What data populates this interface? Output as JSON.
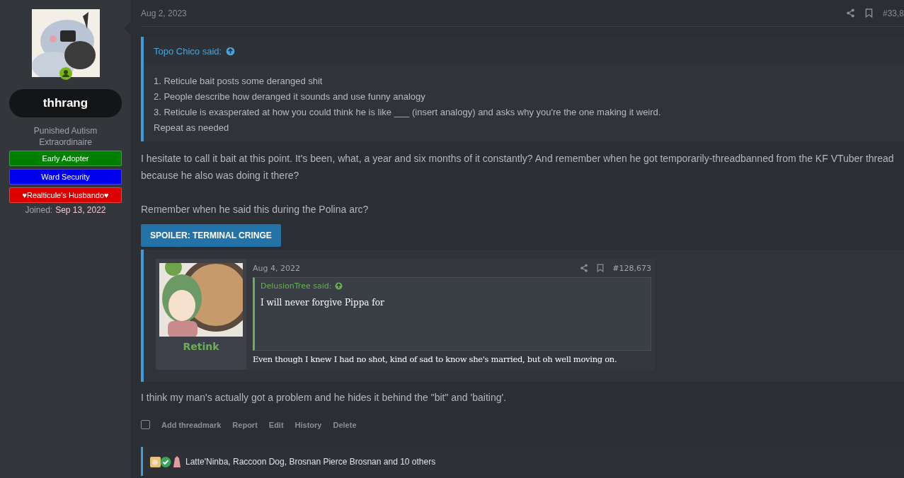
{
  "user": {
    "name": "thhrang",
    "title": "Punished Autism Extraordinaire",
    "banners": [
      {
        "label": "Early Adopter",
        "color": "#008000"
      },
      {
        "label": "Ward Security",
        "color": "#0000ee"
      },
      {
        "label": "♥Realticule's Husbando♥",
        "color": "#dd0000"
      }
    ],
    "joined_label": "Joined:",
    "joined": "Sep 13, 2022"
  },
  "post": {
    "date": "Aug 2, 2023",
    "number": "#33,8",
    "quote": {
      "author": "Topo Chico said:",
      "lines": [
        "1. Reticule bait posts some deranged shit",
        "2. People describe how deranged it sounds and use funny analogy",
        "3. Reticule is exasperated at how you could think he is like ___ (insert analogy) and asks why you're the one making it weird.",
        "Repeat as needed"
      ]
    },
    "paragraphs": [
      "I hesitate to call it bait at this point. It's been, what, a year and six months of it constantly? And remember when he got temporarily-threadbanned from the KF VTuber thread because he also was doing it there?",
      "Remember when he said this during the Polina arc?"
    ],
    "spoiler": "SPOILER: TERMINAL CRINGE",
    "embedded": {
      "username": "Retink",
      "date": "Aug 4, 2022",
      "number": "#128,673",
      "quote_author": "DelusionTree said:",
      "quote_text": "I will never forgive Pippa for",
      "text": "Even though I knew I had no shot, kind of sad to know she's married, but oh well moving on."
    },
    "closing": "I think my man's actually got a problem and he hides it behind the \"bit\" and 'baiting'.",
    "select": {
      "checked": false
    },
    "actions": [
      "Add threadmark",
      "Report",
      "Edit",
      "History",
      "Delete"
    ],
    "reactions": "Latte'Ninba, Raccoon Dog, Brosnan Pierce Brosnan and 10 others"
  }
}
